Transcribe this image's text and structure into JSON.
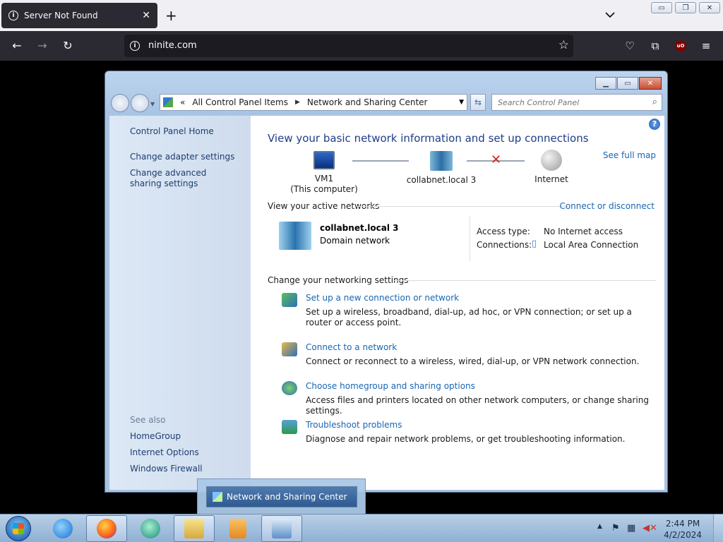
{
  "browser": {
    "tab_title": "Server Not Found",
    "tab_close": "✕",
    "new_tab": "+",
    "url": "ninite.com",
    "back": "←",
    "forward": "→",
    "reload": "↻",
    "star": "☆",
    "menu": "≡",
    "pocket": "♡",
    "extensions": "⧉",
    "ublock": "uO"
  },
  "window": {
    "address": {
      "root": "«",
      "crumb1": "All Control Panel Items",
      "crumb2": "Network and Sharing Center"
    },
    "search_placeholder": "Search Control Panel",
    "sidebar": {
      "home": "Control Panel Home",
      "links": [
        "Change adapter settings",
        "Change advanced sharing settings"
      ],
      "see_also": "See also",
      "see_also_links": [
        "HomeGroup",
        "Internet Options",
        "Windows Firewall"
      ]
    },
    "main": {
      "heading": "View your basic network information and set up connections",
      "see_full_map": "See full map",
      "map": {
        "computer_name": "VM1",
        "computer_sub": "(This computer)",
        "network_name": "collabnet.local  3",
        "internet": "Internet"
      },
      "active_networks": {
        "title": "View your active networks",
        "connect_link": "Connect or disconnect",
        "network_name": "collabnet.local  3",
        "network_type": "Domain network",
        "access_type_label": "Access type:",
        "access_type_value": "No Internet access",
        "connections_label": "Connections:",
        "connections_value": "Local Area Connection"
      },
      "settings": {
        "title": "Change your networking settings",
        "tasks": [
          {
            "link": "Set up a new connection or network",
            "desc": "Set up a wireless, broadband, dial-up, ad hoc, or VPN connection; or set up a router or access point."
          },
          {
            "link": "Connect to a network",
            "desc": "Connect or reconnect to a wireless, wired, dial-up, or VPN network connection."
          },
          {
            "link": "Choose homegroup and sharing options",
            "desc": "Access files and printers located on other network computers, or change sharing settings."
          },
          {
            "link": "Troubleshoot problems",
            "desc": "Diagnose and repair network problems, or get troubleshooting information."
          }
        ]
      }
    }
  },
  "taskbar": {
    "thumbnail_label": "Network and Sharing Center",
    "time": "2:44 PM",
    "date": "4/2/2024",
    "tray_arrow": "▲"
  },
  "colors": {
    "link": "#1866b4",
    "heading": "#1e3d88",
    "browser_dark": "#2b2a33"
  }
}
